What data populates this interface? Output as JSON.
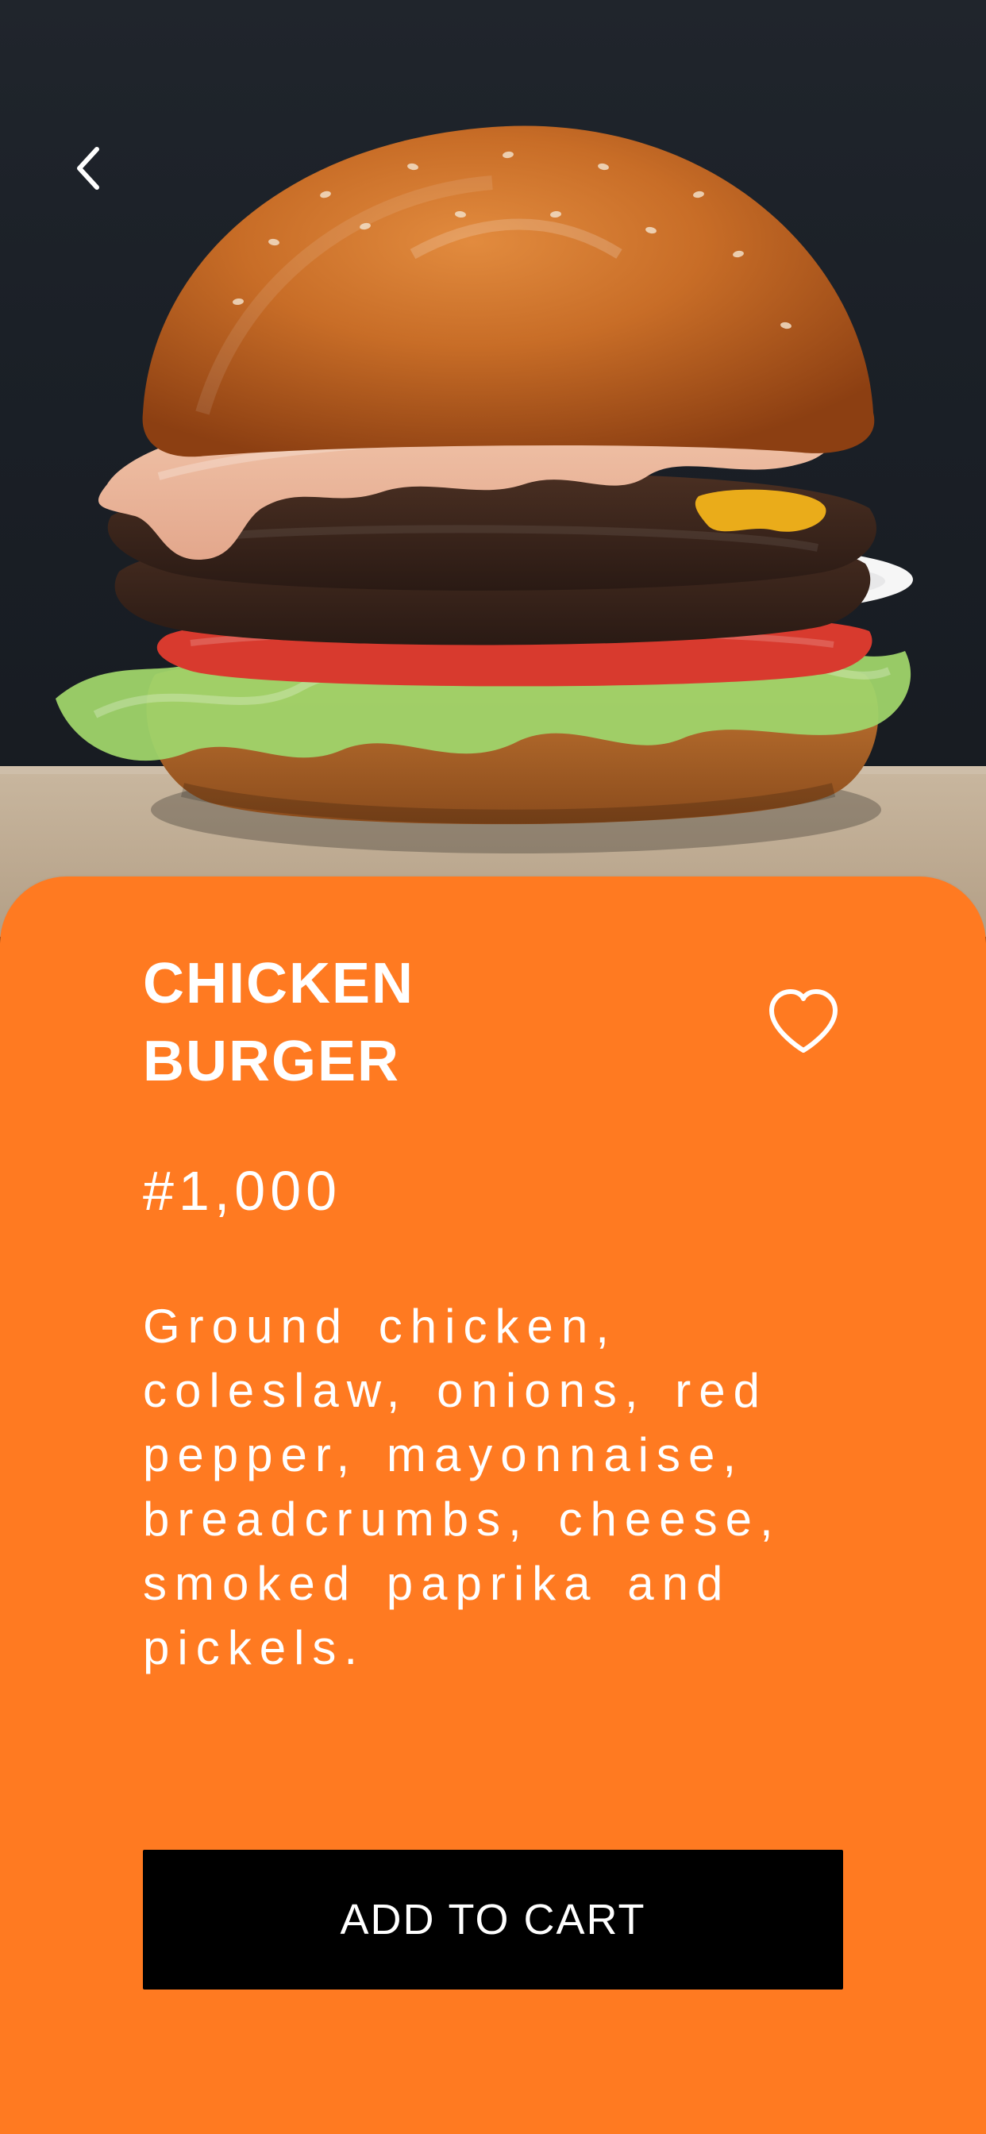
{
  "product": {
    "title_line1": "CHICKEN",
    "title_line2": "BURGER",
    "price": "#1,000",
    "description": "Ground chicken,\ncoleslaw, onions, red\npepper, mayonnaise,\nbreadcrumbs, cheese,\nsmoked paprika and\npickels."
  },
  "actions": {
    "add_to_cart_label": "ADD TO CART"
  },
  "icons": {
    "back": "chevron-left-icon",
    "favorite": "heart-outline-icon"
  },
  "colors": {
    "accent": "#ff7a21",
    "button_bg": "#000000",
    "text": "#ffffff",
    "hero_bg": "#1b2027"
  }
}
